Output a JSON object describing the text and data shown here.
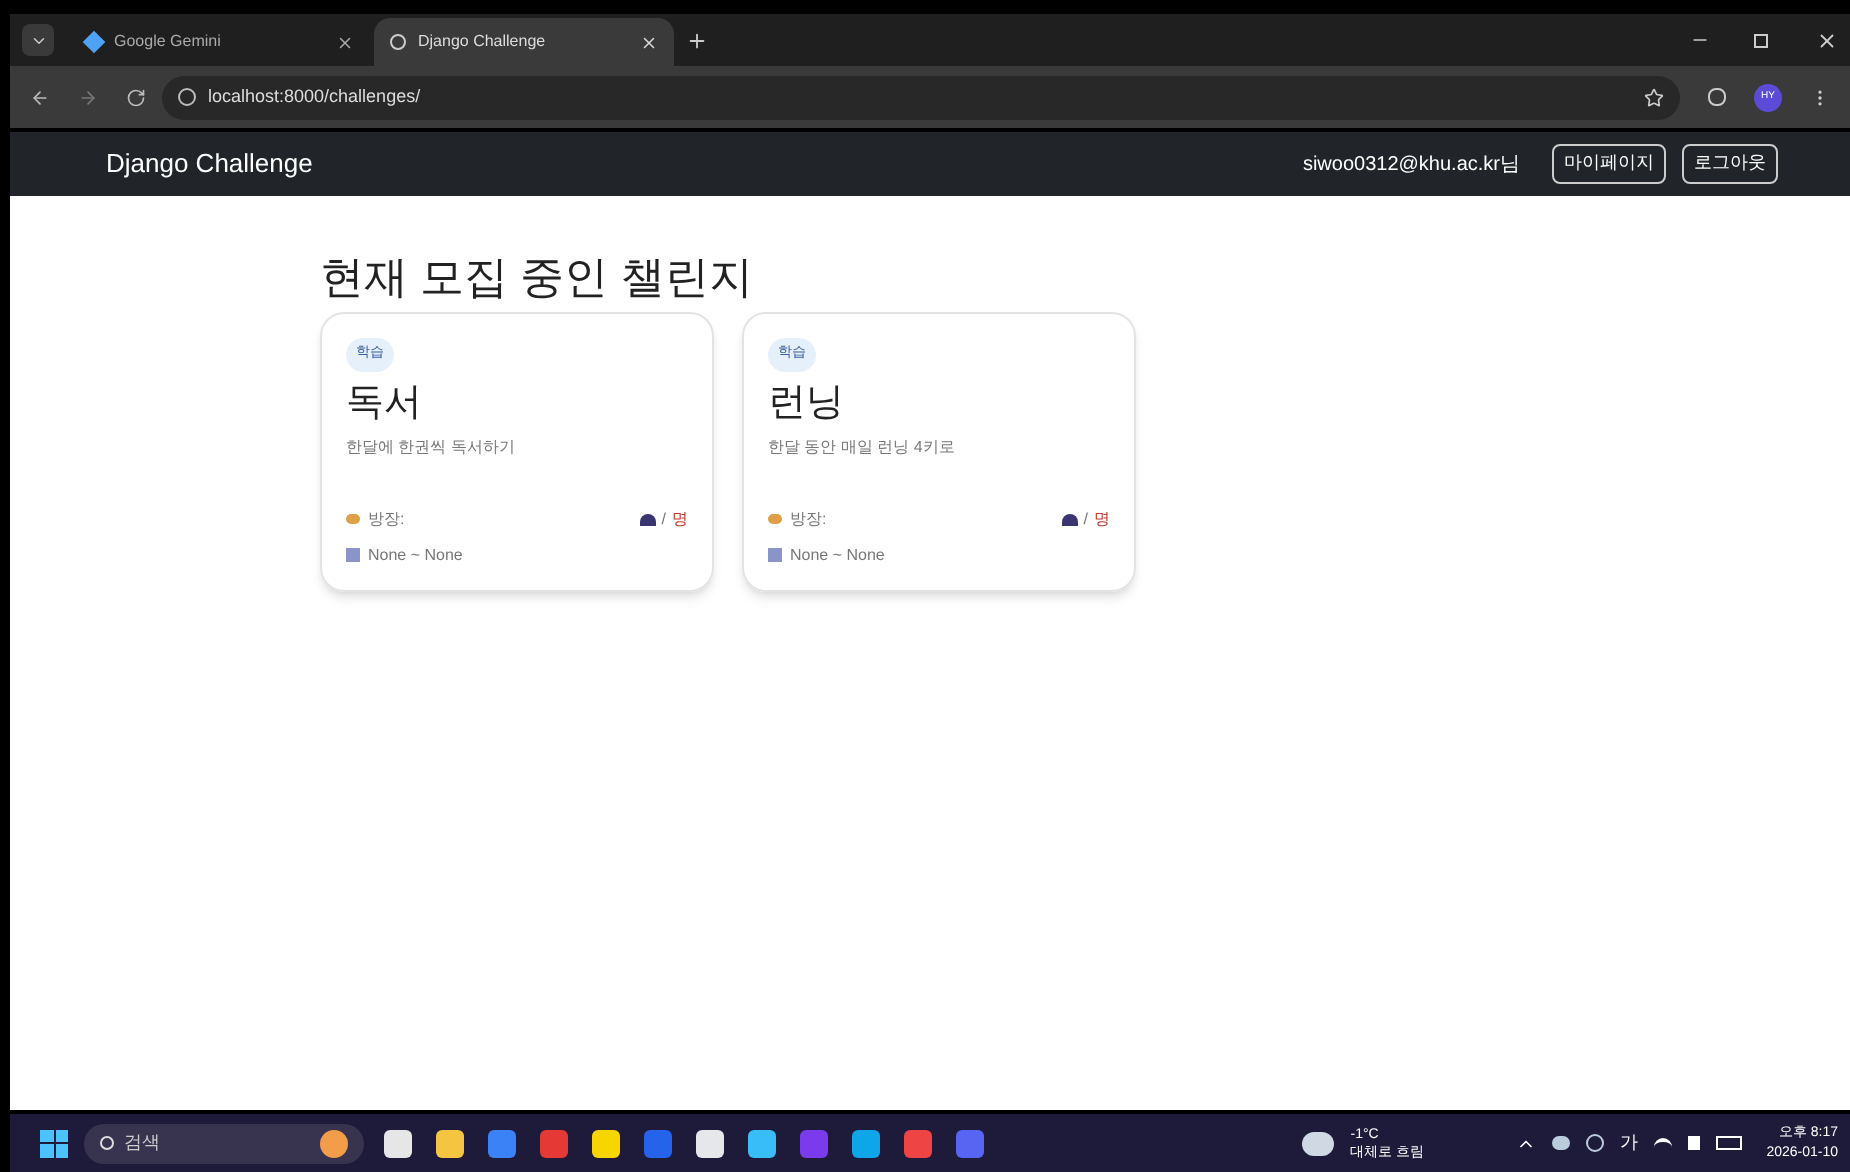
{
  "browser": {
    "tabs": [
      {
        "title": "Google Gemini",
        "selected": false
      },
      {
        "title": "Django Challenge",
        "selected": true
      }
    ],
    "url": "localhost:8000/challenges/",
    "profile": "HY"
  },
  "navbar": {
    "brand": "Django Challenge",
    "user": "siwoo0312@khu.ac.kr님",
    "buttons": [
      "마이페이지",
      "로그아웃"
    ]
  },
  "heading": "현재 모집 중인 챌린지",
  "challenges": [
    {
      "tag": "학습",
      "title": "독서",
      "description": "한달에 한권씩 독서하기",
      "host_label": "방장:",
      "members_sep": "/",
      "members_unit": "명",
      "period": "None ~ None"
    },
    {
      "tag": "학습",
      "title": "런닝",
      "description": "한달 동안 매일 런닝 4키로",
      "host_label": "방장:",
      "members_sep": "/",
      "members_unit": "명",
      "period": "None ~ None"
    }
  ],
  "taskbar": {
    "search_placeholder": "검색",
    "temperature": "-1°C",
    "weather": "대체로 흐림",
    "ime": "가",
    "time": "오후 8:17",
    "date": "2026-01-10"
  }
}
